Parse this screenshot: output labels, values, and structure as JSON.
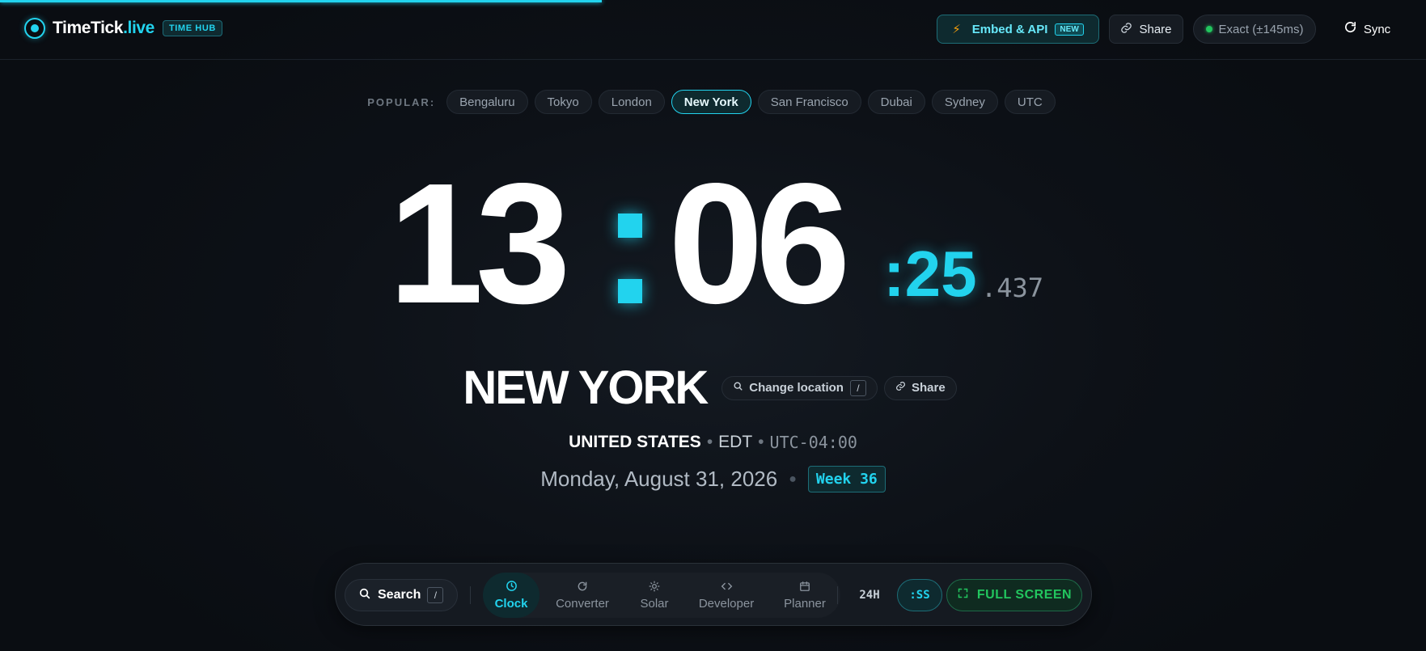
{
  "header": {
    "brand_name": "TimeTick",
    "brand_suffix": ".live",
    "brand_tag": "TIME HUB",
    "embed_label": "Embed & API",
    "embed_badge": "NEW",
    "share_label": "Share",
    "exact_label": "Exact (±145ms)",
    "sync_label": "Sync"
  },
  "popular": {
    "label": "POPULAR:",
    "cities": [
      "Bengaluru",
      "Tokyo",
      "London",
      "New York",
      "San Francisco",
      "Dubai",
      "Sydney",
      "UTC"
    ],
    "active": "New York"
  },
  "clock": {
    "hours": "13",
    "minutes": "06",
    "seconds": ":25",
    "millis": ".437"
  },
  "location": {
    "city": "NEW YORK",
    "change_label": "Change location",
    "change_shortcut": "/",
    "share_label": "Share",
    "country": "UNITED STATES",
    "timezone": "EDT",
    "offset": "UTC-04:00",
    "date": "Monday, August 31, 2026",
    "week": "Week 36"
  },
  "dock": {
    "search_label": "Search",
    "search_shortcut": "/",
    "tabs": [
      {
        "label": "Clock",
        "icon": "clock-icon"
      },
      {
        "label": "Converter",
        "icon": "refresh-icon"
      },
      {
        "label": "Solar",
        "icon": "sun-icon"
      },
      {
        "label": "Developer",
        "icon": "code-icon"
      },
      {
        "label": "Planner",
        "icon": "calendar-icon"
      }
    ],
    "active_tab": "Clock",
    "format_label": "24H",
    "seconds_label": ":SS",
    "fullscreen_label": "FULL SCREEN"
  },
  "colors": {
    "accent": "#22d3ee",
    "success": "#22c55e",
    "background": "#0d1117"
  }
}
